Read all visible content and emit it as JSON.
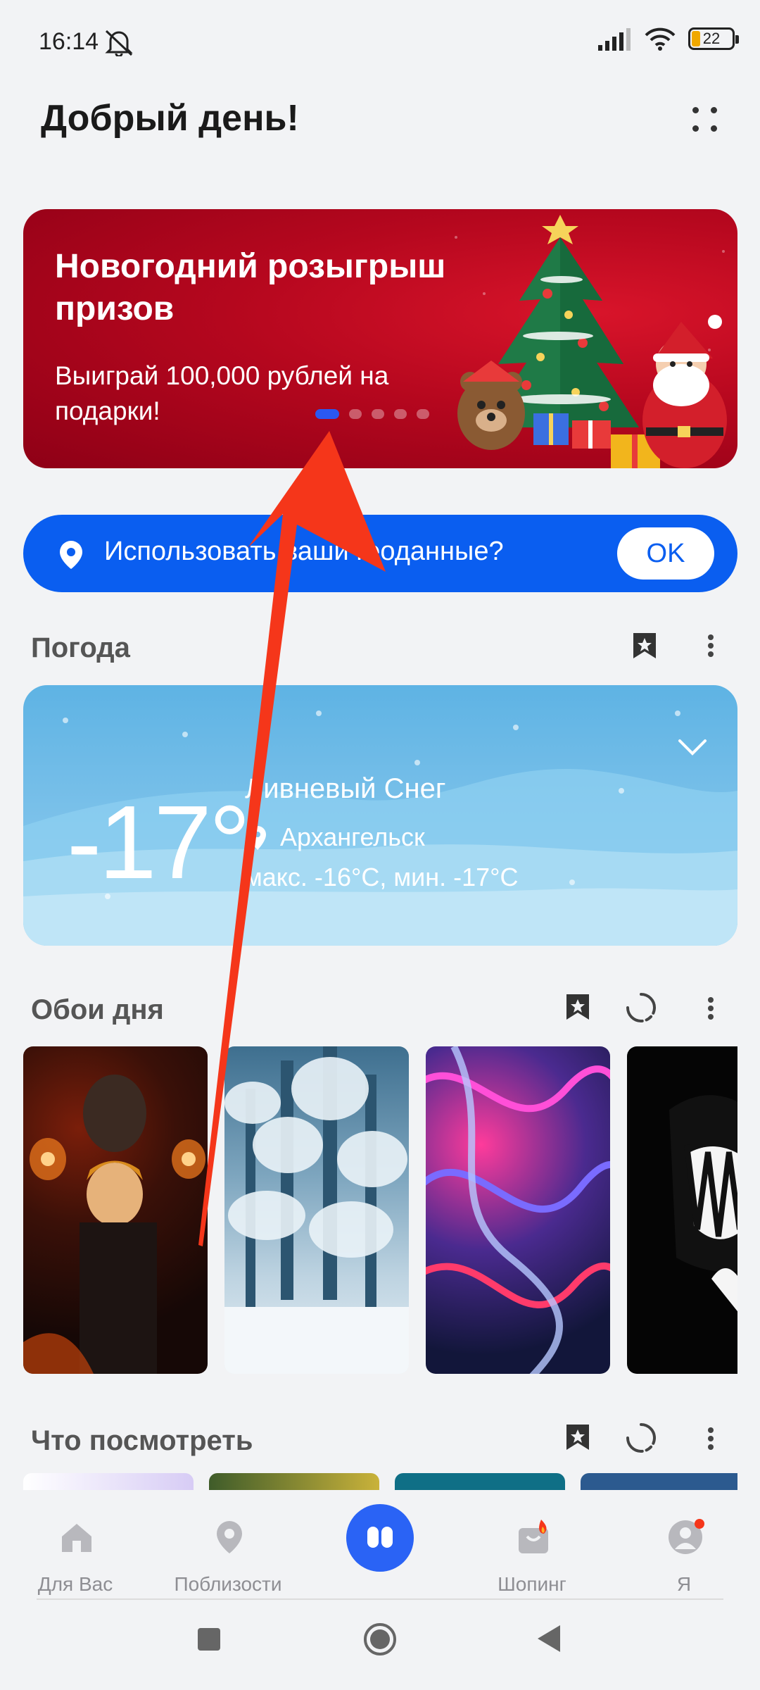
{
  "status_bar": {
    "time": "16:14",
    "battery_level": "22"
  },
  "header": {
    "greeting": "Добрый день!"
  },
  "promo": {
    "title": "Новогодний розыгрыш призов",
    "subtitle": "Выиграй 100,000 рублей на подарки!",
    "active_slide": 1,
    "slide_count": 5,
    "background_color": "#b5071e"
  },
  "location_prompt": {
    "text": "Использовать ваши геоданные?",
    "ok_label": "OK",
    "color": "#0a5ef0"
  },
  "weather": {
    "section_title": "Погода",
    "temperature": "-17°",
    "condition": "Ливневый Снег",
    "city": "Архангельск",
    "range": "макс. -16°C, мин. -17°C"
  },
  "wallpapers": {
    "section_title": "Обои дня",
    "items": [
      "wallpaper-dark-anime",
      "wallpaper-snowy-forest",
      "wallpaper-neon-waves",
      "wallpaper-monochrome-anime"
    ]
  },
  "watch": {
    "section_title": "Что посмотреть"
  },
  "bottom_nav": {
    "items": [
      {
        "label": "Для Вас",
        "icon": "home-icon"
      },
      {
        "label": "Поблизости",
        "icon": "location-icon"
      },
      {
        "label": "",
        "icon": "assistant-icon"
      },
      {
        "label": "Шопинг",
        "icon": "shopping-bag-icon"
      },
      {
        "label": "Я",
        "icon": "profile-icon"
      }
    ],
    "accent_color": "#2a63f5"
  },
  "overlay": {
    "annotation": "arrow-pointing-up",
    "color": "#f5361a"
  }
}
